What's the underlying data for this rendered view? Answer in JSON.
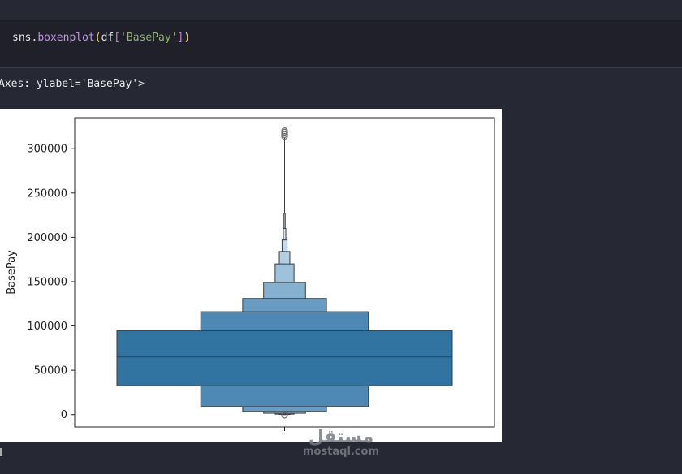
{
  "code": {
    "module": "sns",
    "dot": ".",
    "function": "boxenplot",
    "open_paren": "(",
    "arg_var": "df",
    "open_bracket": "[",
    "arg_key": "'BasePay'",
    "close_bracket": "]",
    "close_paren": ")"
  },
  "output": {
    "repr_text": "Axes: ylabel='BasePay'>"
  },
  "watermark": {
    "logo_text": "مستقل",
    "url": "mostaql.com"
  },
  "chart_data": {
    "type": "boxen",
    "library": "seaborn",
    "ylabel": "BasePay",
    "xlabel": "",
    "ylim": [
      -14000,
      335000
    ],
    "yticks": [
      0,
      50000,
      100000,
      150000,
      200000,
      250000,
      300000
    ],
    "ytick_labels": [
      "0",
      "50000",
      "100000",
      "150000",
      "200000",
      "250000",
      "300000"
    ],
    "median": 65000,
    "boxes": [
      {
        "lower": 32500,
        "upper": 94500,
        "width_frac": 0.8,
        "color": "#3274a1"
      },
      {
        "lower": 9000,
        "upper": 116000,
        "width_frac": 0.4,
        "color": "#4e88b5"
      },
      {
        "lower": 3500,
        "upper": 131000,
        "width_frac": 0.2,
        "color": "#6a9cc3"
      },
      {
        "lower": 1500,
        "upper": 149000,
        "width_frac": 0.1,
        "color": "#86b0d0"
      },
      {
        "lower": 500,
        "upper": 170000,
        "width_frac": 0.045,
        "color": "#9ec2dc"
      },
      {
        "lower": 200,
        "upper": 184000,
        "width_frac": 0.025,
        "color": "#b2cfe4"
      },
      {
        "lower": 100,
        "upper": 197000,
        "width_frac": 0.012,
        "color": "#c3dbec"
      },
      {
        "lower": 50,
        "upper": 210000,
        "width_frac": 0.006,
        "color": "#d3e4f2"
      },
      {
        "lower": 0,
        "upper": 227000,
        "width_frac": 0.003,
        "color": "#dfebf6"
      }
    ],
    "whisker_top": 313000,
    "outliers": [
      314000,
      316000,
      318500,
      320000,
      -600
    ],
    "grid": false,
    "legend": "none"
  }
}
